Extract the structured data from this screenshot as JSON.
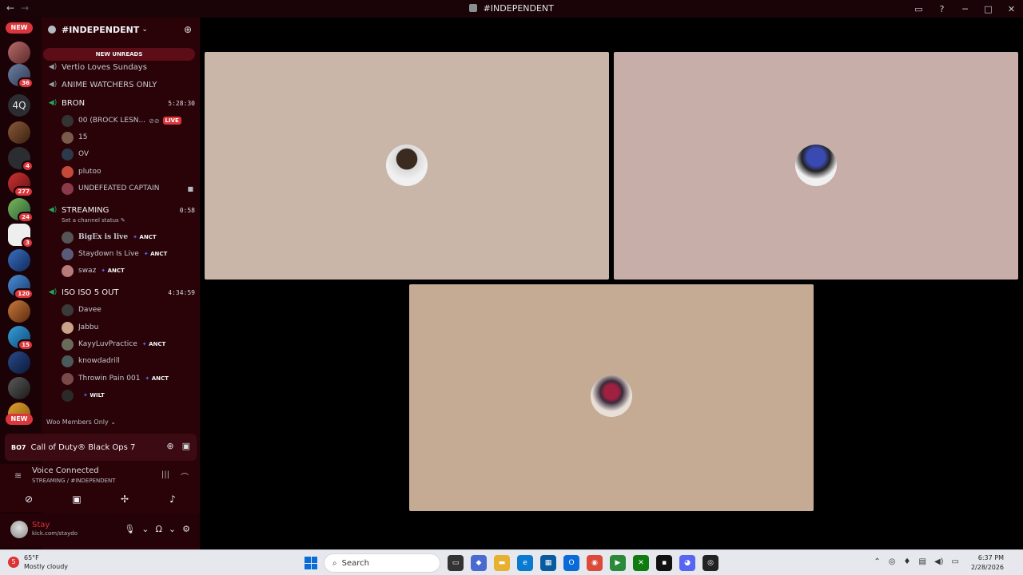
{
  "window": {
    "title": "#INDEPENDENT",
    "back": "←",
    "forward": "→",
    "inbox_icon": "inbox-icon",
    "help_icon": "help-icon",
    "minimize": "─",
    "maximize": "□",
    "close": "✕"
  },
  "rail": {
    "new_top": "NEW",
    "new_bottom": "NEW",
    "text_server": "4Q",
    "badges": [
      "36",
      "4",
      "277",
      "24",
      "3",
      "120",
      "15"
    ]
  },
  "server": {
    "name": "#INDEPENDENT",
    "new_unreads": "NEW UNREADS"
  },
  "channels": {
    "vertio": "Vertio Loves Sundays",
    "anime": "ANIME WATCHERS ONLY",
    "bron": "BRON",
    "bron_time": "5:28:30",
    "streaming": "STREAMING",
    "streaming_time": "0:58",
    "streaming_status": "Set a channel status",
    "iso": "ISO ISO 5 OUT",
    "iso_time": "4:34:59",
    "category": "Woo Members Only"
  },
  "bron_users": [
    {
      "name": "00 (BROCK LESN...",
      "live": "LIVE"
    },
    {
      "name": "15"
    },
    {
      "name": "OV"
    },
    {
      "name": "plutoo"
    },
    {
      "name": "UNDEFEATED CAPTAIN"
    }
  ],
  "streaming_users": [
    {
      "name": "BigEx is live",
      "tag": "ANCT"
    },
    {
      "name": "Staydown Is Live",
      "tag": "ANCT"
    },
    {
      "name": "swaz",
      "tag": "ANCT"
    }
  ],
  "iso_users": [
    {
      "name": "Davee"
    },
    {
      "name": "Jabbu"
    },
    {
      "name": "KayyLuvPractice",
      "tag": "ANCT"
    },
    {
      "name": "knowdadrill"
    },
    {
      "name": "Throwin Pain 001",
      "tag": "ANCT"
    },
    {
      "name": "",
      "tag": "WILT"
    }
  ],
  "game": {
    "logo": "BO7",
    "title": "Call of Duty® Black Ops 7"
  },
  "voice": {
    "status": "Voice Connected",
    "location": "STREAMING / #INDEPENDENT"
  },
  "me": {
    "name": "Stay",
    "status": "kick.com/staydo"
  },
  "taskbar": {
    "temp": "65°F",
    "weather": "Mostly cloudy",
    "search_placeholder": "Search",
    "time": "6:37 PM",
    "date": "2/28/2026"
  },
  "colors": {
    "sidebar_bg": "#2a0309",
    "rail_bg": "#1b0206",
    "accent_red": "#da373c",
    "voice_green": "#23a55a",
    "tile1": "#c9b6a8",
    "tile2": "#c8aea8",
    "tile3": "#c6ab94"
  }
}
